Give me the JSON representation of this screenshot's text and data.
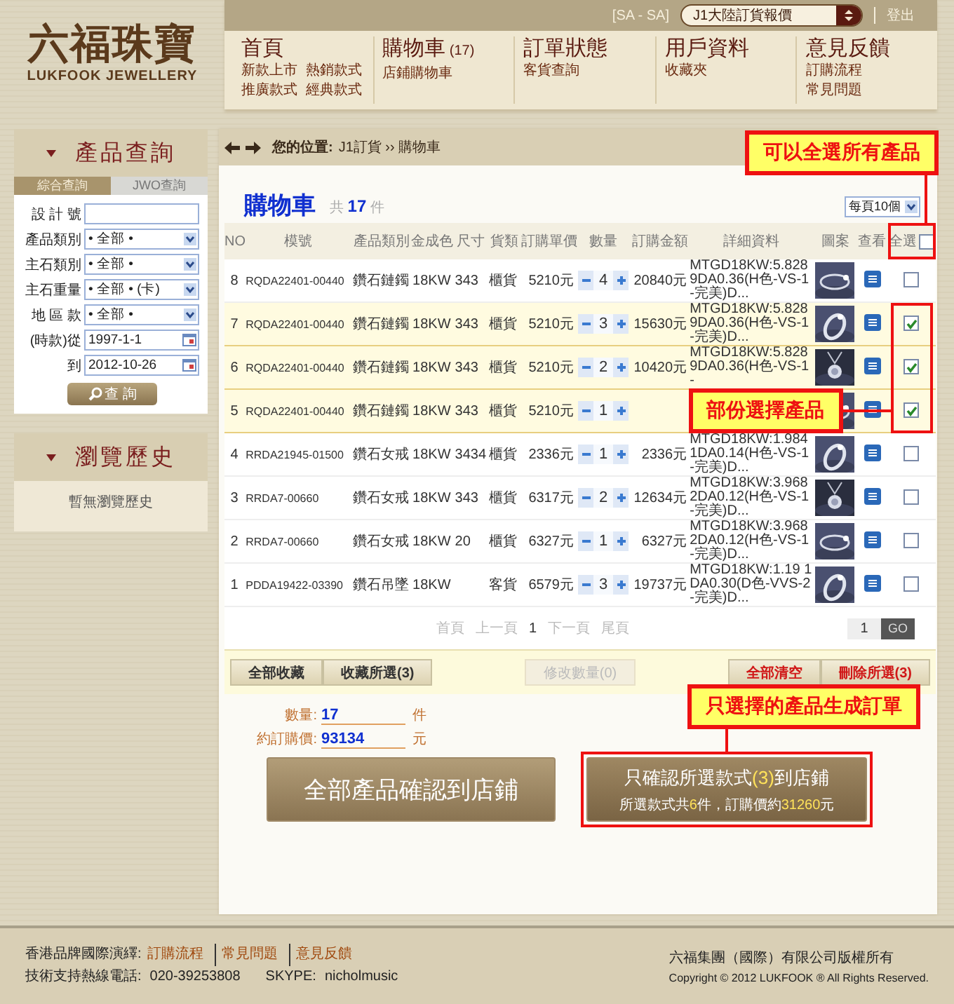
{
  "header": {
    "logo": {
      "chinese": "六福珠寶",
      "english": "LUKFOOK JEWELLERY"
    },
    "top_bar": {
      "user": "[SA - SA]",
      "region_select": "J1大陸訂貨報價",
      "logout": "登出"
    },
    "nav": [
      {
        "title": "首頁",
        "links": [
          "新款上市",
          "熱銷款式",
          "推廣款式",
          "經典款式"
        ]
      },
      {
        "title": "購物車",
        "count": "(17)",
        "links": [
          "店鋪購物車"
        ]
      },
      {
        "title": "訂單狀態",
        "links": [
          "客貨查詢"
        ]
      },
      {
        "title": "用戶資料",
        "links": [
          "收藏夾"
        ]
      },
      {
        "title": "意見反饋",
        "links": [
          "訂購流程",
          "常見問題"
        ]
      }
    ]
  },
  "sidebar": {
    "query": {
      "title": "產品查詢",
      "tabs": [
        {
          "label": "綜合查詢",
          "selected": true
        },
        {
          "label": "JWO查詢",
          "selected": false
        }
      ],
      "fields": [
        {
          "label": "設 計 號",
          "kind": "text"
        },
        {
          "label": "產品類別",
          "kind": "select",
          "value": "• 全部 •"
        },
        {
          "label": "主石類別",
          "kind": "select",
          "value": "• 全部 •"
        },
        {
          "label": "主石重量",
          "kind": "select",
          "value": "• 全部 • (卡)"
        },
        {
          "label": "地 區 款",
          "kind": "select",
          "value": "• 全部 •"
        },
        {
          "label": "(時款)從",
          "kind": "date",
          "value": "1997-1-1"
        },
        {
          "label": "到",
          "kind": "date",
          "value": "2012-10-26"
        }
      ],
      "search_button": "查 詢"
    },
    "history": {
      "title": "瀏覽歷史",
      "empty_text": "暫無瀏覽歷史"
    }
  },
  "breadcrumb": {
    "label": "您的位置:",
    "path": "J1訂貨 ›› 購物車"
  },
  "cart": {
    "title": "購物車",
    "count_prefix": "共",
    "count": "17",
    "count_suffix": "件",
    "page_size": "每頁10個",
    "columns": [
      "NO",
      "模號",
      "產品類別",
      "金成色",
      "尺寸",
      "貨類",
      "訂購單價",
      "數量",
      "訂購金額",
      "詳細資料",
      "圖案",
      "查看"
    ],
    "select_all": {
      "label": "全選",
      "checked": false
    },
    "rows": [
      {
        "no": "8",
        "model": "RQDA22401-00440",
        "category": "鑽石鏈鐲",
        "gold": "18KW",
        "size": "343",
        "type": "櫃貨",
        "price": "5210元",
        "quantity": "4",
        "amount": "20840元",
        "details": "MTGD18KW:5.828 9DA0.36(H色-VS-1-完美)D...",
        "selected": false
      },
      {
        "no": "7",
        "model": "RQDA22401-00440",
        "category": "鑽石鏈鐲",
        "gold": "18KW",
        "size": "343",
        "type": "櫃貨",
        "price": "5210元",
        "quantity": "3",
        "amount": "15630元",
        "details": "MTGD18KW:5.828 9DA0.36(H色-VS-1-完美)D...",
        "selected": true
      },
      {
        "no": "6",
        "model": "RQDA22401-00440",
        "category": "鑽石鏈鐲",
        "gold": "18KW",
        "size": "343",
        "type": "櫃貨",
        "price": "5210元",
        "quantity": "2",
        "amount": "10420元",
        "details": "MTGD18KW:5.828 9DA0.36(H色-VS-1-",
        "selected": true
      },
      {
        "no": "5",
        "model": "RQDA22401-00440",
        "category": "鑽石鏈鐲",
        "gold": "18KW",
        "size": "343",
        "type": "櫃貨",
        "price": "5210元",
        "quantity": "1",
        "selected": true
      },
      {
        "no": "4",
        "model": "RRDA21945-01500",
        "category": "鑽石女戒",
        "gold": "18KW",
        "size": "3434",
        "type": "櫃貨",
        "price": "2336元",
        "quantity": "1",
        "amount": "2336元",
        "details": "MTGD18KW:1.984 1DA0.14(H色-VS-1-完美)D...",
        "selected": false
      },
      {
        "no": "3",
        "model": "RRDA7-00660",
        "category": "鑽石女戒",
        "gold": "18KW",
        "size": "343",
        "type": "櫃貨",
        "price": "6317元",
        "quantity": "2",
        "amount": "12634元",
        "details": "MTGD18KW:3.968 2DA0.12(H色-VS-1-完美)D...",
        "selected": false
      },
      {
        "no": "2",
        "model": "RRDA7-00660",
        "category": "鑽石女戒",
        "gold": "18KW",
        "size": "20",
        "type": "櫃貨",
        "price": "6327元",
        "quantity": "1",
        "amount": "6327元",
        "details": "MTGD18KW:3.968 2DA0.12(H色-VS-1-完美)D...",
        "selected": false
      },
      {
        "no": "1",
        "model": "PDDA19422-03390",
        "category": "鑽石吊墜",
        "gold": "18KW",
        "type": "客貨",
        "price": "6579元",
        "quantity": "3",
        "amount": "19737元",
        "details": "MTGD18KW:1.19 1DA0.30(D色-VVS-2-完美)D...",
        "selected": false
      }
    ],
    "pagination": {
      "links": [
        "首頁",
        "上一頁"
      ],
      "current": "1",
      "links_after": [
        "下一頁",
        "尾頁"
      ],
      "page_input": "1",
      "go": "GO"
    },
    "actions": [
      {
        "label": "全部收藏",
        "kind": "left",
        "disabled": false
      },
      {
        "label": "收藏所選(3)",
        "kind": "left",
        "disabled": false
      },
      {
        "label": "修改數量(0)",
        "kind": "middle",
        "disabled": true
      },
      {
        "label": "全部清空",
        "kind": "right",
        "disabled": false
      },
      {
        "label": "刪除所選(3)",
        "kind": "right",
        "disabled": false
      }
    ]
  },
  "totals": [
    {
      "label": "數量:",
      "value": "17",
      "unit": "件"
    },
    {
      "label": "約訂購價:",
      "value": "93134",
      "unit": "元"
    }
  ],
  "confirm_all": "全部產品確認到店鋪",
  "confirm_selected": {
    "title": [
      {
        "text": "只確認所選款式",
        "highlight": false
      },
      {
        "text": "(3)",
        "highlight": true
      },
      {
        "text": "到店鋪",
        "highlight": false
      }
    ],
    "summary": [
      {
        "text": "所選款式共",
        "highlight": false
      },
      {
        "text": "6",
        "highlight": true
      },
      {
        "text": "件，訂購價約",
        "highlight": false
      },
      {
        "text": "31260",
        "highlight": true
      },
      {
        "text": "元",
        "highlight": false
      }
    ]
  },
  "annotations": [
    {
      "text": "可以全選所有產品",
      "kind": "select-all"
    },
    {
      "text": "部份選擇產品",
      "kind": "selected-rows"
    },
    {
      "text": "只選擇的產品生成訂單",
      "kind": "confirm-selected"
    }
  ],
  "footer": {
    "brand_label": "香港品牌國際演繹:",
    "links": [
      "訂購流程",
      "常見問題",
      "意見反饋"
    ],
    "hotline_label": "技術支持熱線電話:",
    "hotline": "020-39253808",
    "skype_label": "SKYPE:",
    "skype": "nicholmusic",
    "company": "六福集團（國際）有限公司版權所有",
    "copyright": "Copyright © 2012 LUKFOOK ® All Rights Reserved."
  }
}
